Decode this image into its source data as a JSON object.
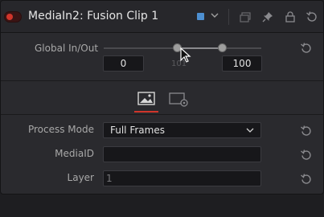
{
  "header": {
    "title": "MediaIn2: Fusion Clip 1",
    "color_swatch": "#4d8fd1",
    "icons": [
      "toggle-icon",
      "color-swatch",
      "chevron-down-icon",
      "copy-icon",
      "pin-icon",
      "lock-icon",
      "reset-icon"
    ]
  },
  "global_inout": {
    "label": "Global In/Out",
    "in_value": "0",
    "out_value": "100",
    "current": "101"
  },
  "tabs": [
    {
      "name": "image-tab",
      "active": true
    },
    {
      "name": "settings-tab",
      "active": false
    }
  ],
  "fields": {
    "process_mode": {
      "label": "Process Mode",
      "value": "Full Frames"
    },
    "media_id": {
      "label": "MediaID",
      "value": ""
    },
    "layer": {
      "label": "Layer",
      "value": "1"
    }
  },
  "colors": {
    "accent_red": "#d0352b",
    "panel_bg": "#2a2a2e",
    "field_bg": "#17171a"
  }
}
